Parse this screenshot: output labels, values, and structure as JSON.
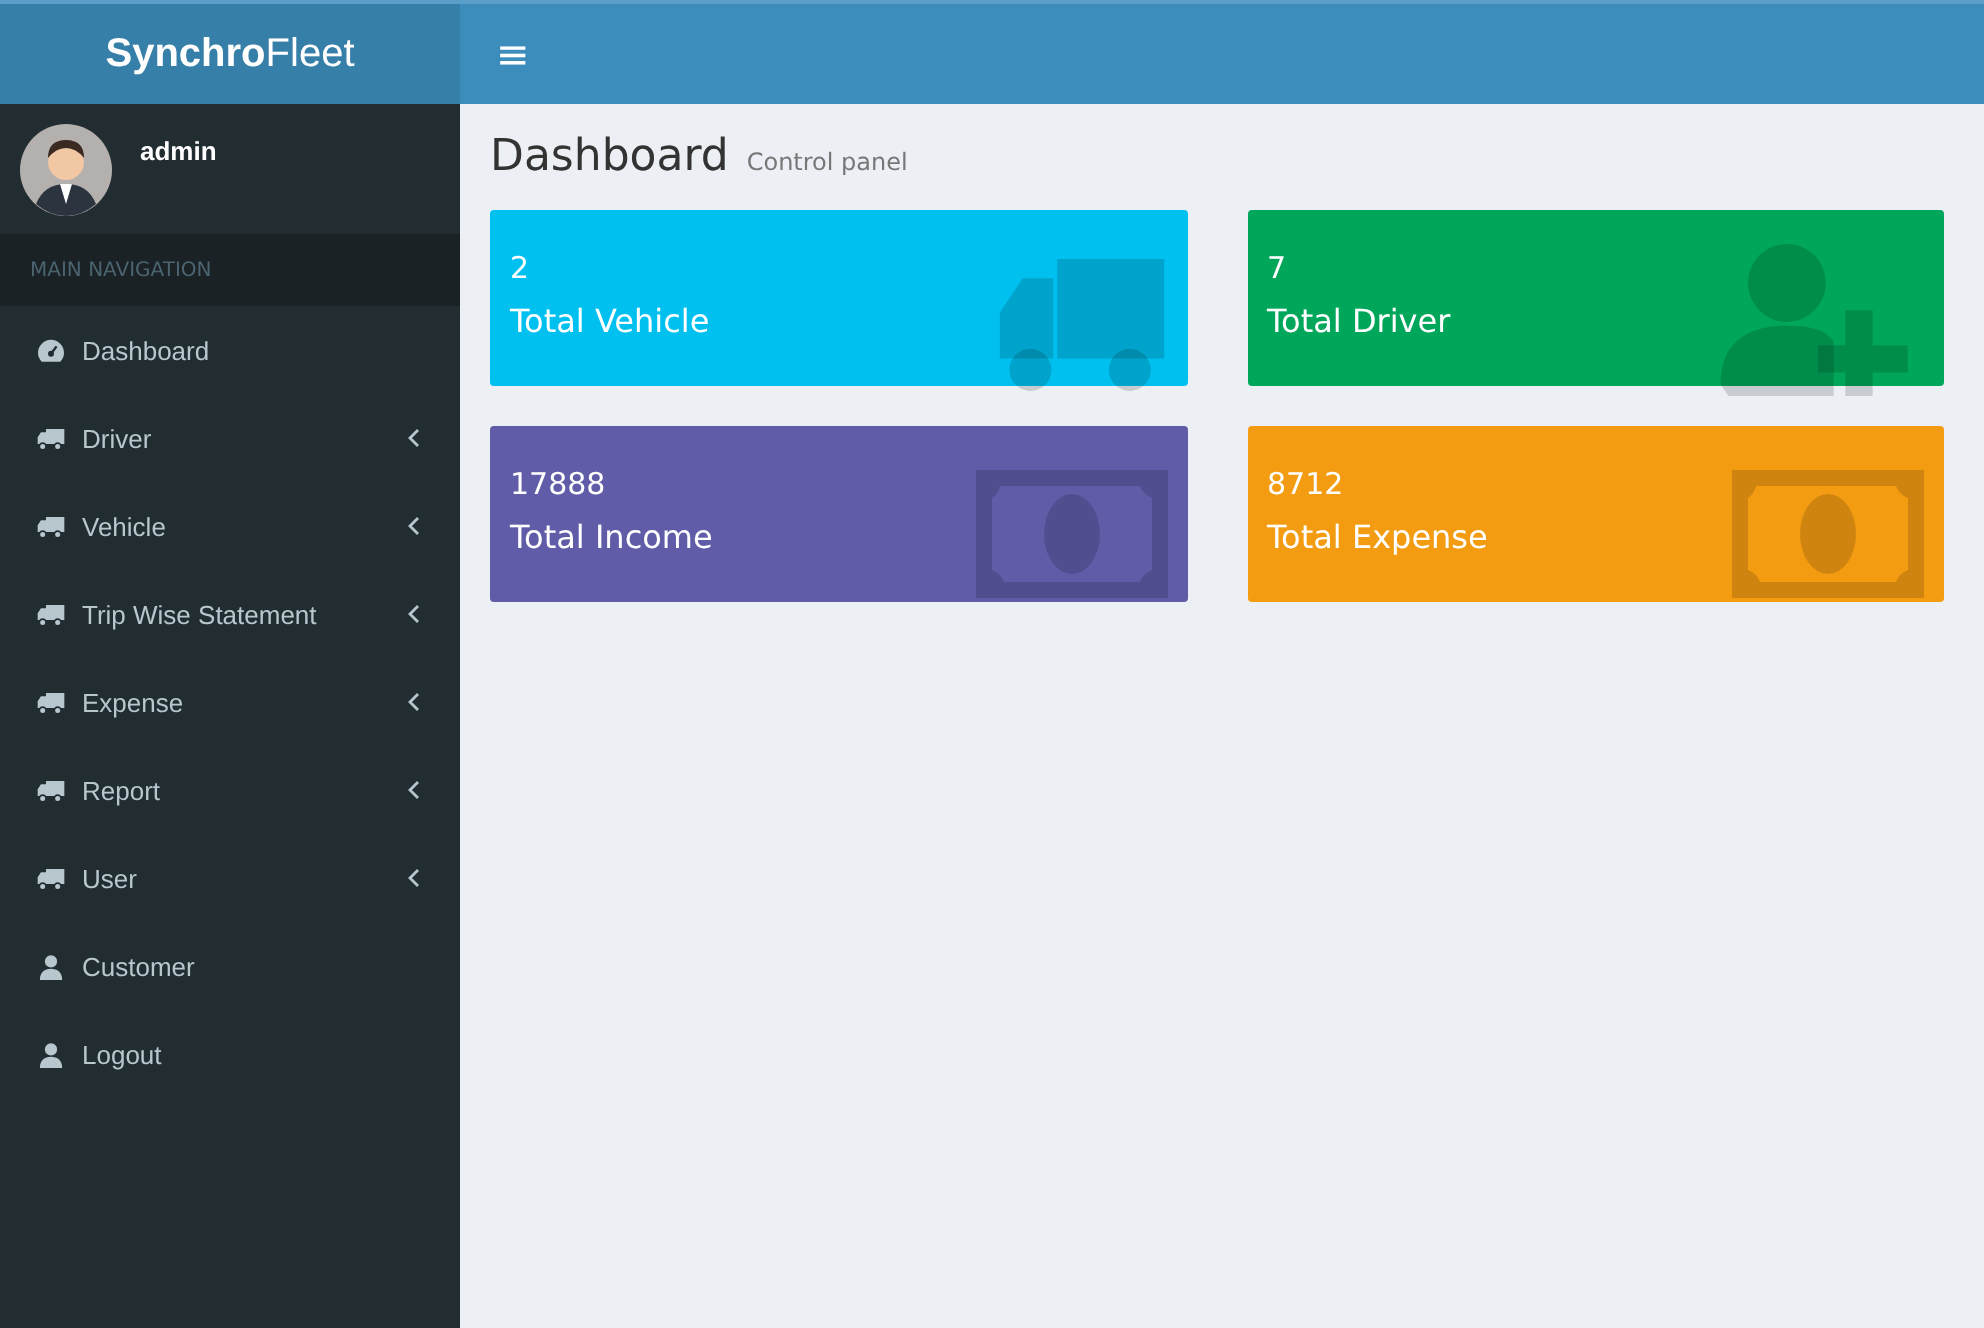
{
  "logo": {
    "bold": "Synchro",
    "rest": "Fleet"
  },
  "topbar": {
    "menu": "≡"
  },
  "user": {
    "name": "admin"
  },
  "sidebar": {
    "header": "MAIN NAVIGATION",
    "items": [
      {
        "label": "Dashboard",
        "kind": "gauge",
        "expandable": false
      },
      {
        "label": "Driver",
        "kind": "truck",
        "expandable": true
      },
      {
        "label": "Vehicle",
        "kind": "truck",
        "expandable": true
      },
      {
        "label": "Trip Wise Statement",
        "kind": "truck",
        "expandable": true
      },
      {
        "label": "Expense",
        "kind": "truck",
        "expandable": true
      },
      {
        "label": "Report",
        "kind": "truck",
        "expandable": true
      },
      {
        "label": "User",
        "kind": "truck",
        "expandable": true
      },
      {
        "label": "Customer",
        "kind": "user",
        "expandable": false
      },
      {
        "label": "Logout",
        "kind": "user",
        "expandable": false
      }
    ]
  },
  "page": {
    "title": "Dashboard",
    "subtitle": "Control panel"
  },
  "cards": [
    {
      "value": "2",
      "label": "Total Vehicle",
      "color": "#00c0ef",
      "kind": "truck"
    },
    {
      "value": "7",
      "label": "Total Driver",
      "color": "#00a65a",
      "kind": "user-plus"
    },
    {
      "value": "17888",
      "label": "Total Income",
      "color": "#605ca8",
      "kind": "money"
    },
    {
      "value": "8712",
      "label": "Total Expense",
      "color": "#f39c12",
      "kind": "money"
    }
  ]
}
